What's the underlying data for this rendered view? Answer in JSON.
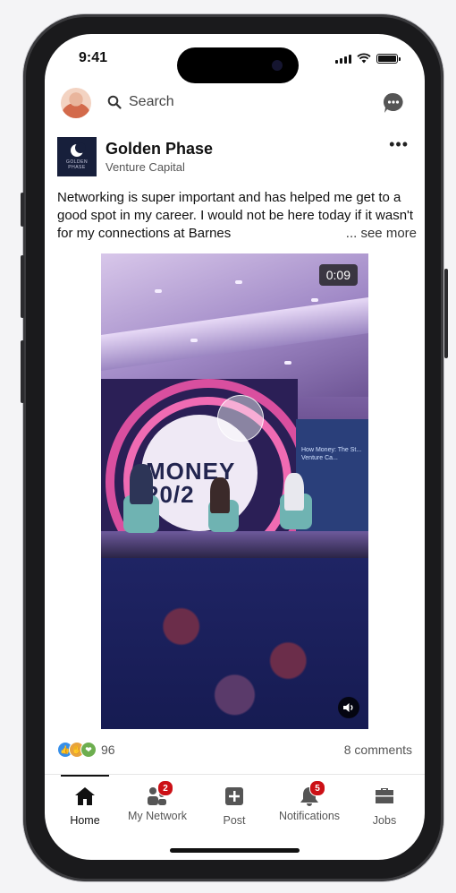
{
  "status": {
    "time": "9:41"
  },
  "topbar": {
    "search_placeholder": "Search"
  },
  "post": {
    "company": "Golden Phase",
    "subtitle": "Venture Capital",
    "logo_text": "GOLDEN PHASE",
    "text": "Networking is super important and has helped me get to a good spot in my career. I would not be here today if it wasn't for my connections at Barnes",
    "see_more": "... see more",
    "video": {
      "duration": "0:09",
      "banner_text": "MONEY 20/2",
      "screen_text": "How Money: The St... Venture Ca..."
    },
    "reactions": {
      "count": "96",
      "icons": [
        "like-icon",
        "celebrate-icon",
        "support-icon"
      ]
    },
    "comments": "8 comments"
  },
  "nav": {
    "items": [
      {
        "label": "Home",
        "icon": "home-icon",
        "active": true
      },
      {
        "label": "My Network",
        "icon": "network-icon",
        "badge": "2"
      },
      {
        "label": "Post",
        "icon": "post-icon"
      },
      {
        "label": "Notifications",
        "icon": "bell-icon",
        "badge": "5"
      },
      {
        "label": "Jobs",
        "icon": "briefcase-icon"
      }
    ]
  },
  "colors": {
    "badge": "#cc1016",
    "logo_bg": "#171f3b",
    "like_blue": "#378fe9"
  }
}
